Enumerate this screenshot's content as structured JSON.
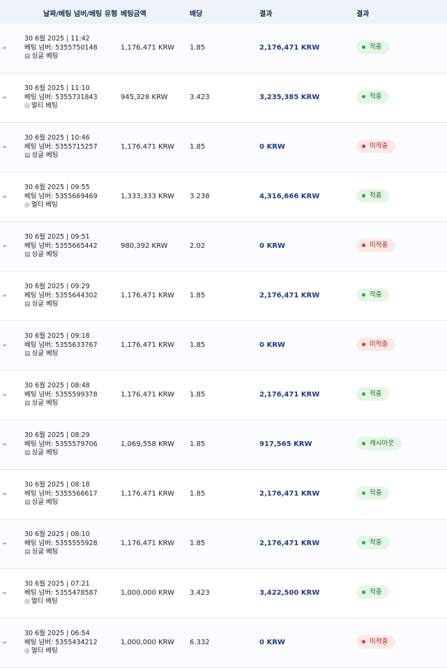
{
  "header": {
    "col_info": "날짜/베팅 넘버/베팅 유형",
    "col_amount": "베팅금액",
    "col_odds": "배당",
    "col_result": "결과",
    "col_status": "결과"
  },
  "rows": [
    {
      "date": "30 6월 2025 | 11:42",
      "bet_number": "베팅 넘버: 5355750148",
      "type_icon": "▤",
      "type": "싱글 베팅",
      "amount": "1,176,471 KRW",
      "odds": "1.85",
      "result": "2,176,471 KRW",
      "status": "적중",
      "status_kind": "win"
    },
    {
      "date": "30 6월 2025 | 11:10",
      "bet_number": "베팅 넘버: 5355731843",
      "type_icon": "◎",
      "type": "멀티 베팅",
      "amount": "945,328 KRW",
      "odds": "3.423",
      "result": "3,235,385 KRW",
      "status": "적중",
      "status_kind": "win"
    },
    {
      "date": "30 6월 2025 | 10:46",
      "bet_number": "베팅 넘버: 5355715257",
      "type_icon": "▤",
      "type": "싱글 베팅",
      "amount": "1,176,471 KRW",
      "odds": "1.85",
      "result": "0 KRW",
      "status": "미적중",
      "status_kind": "lose"
    },
    {
      "date": "30 6월 2025 | 09:55",
      "bet_number": "베팅 넘버: 5355669469",
      "type_icon": "◎",
      "type": "멀티 베팅",
      "amount": "1,333,333 KRW",
      "odds": "3.238",
      "result": "4,316,666 KRW",
      "status": "적중",
      "status_kind": "win"
    },
    {
      "date": "30 6월 2025 | 09:51",
      "bet_number": "베팅 넘버: 5355665442",
      "type_icon": "▤",
      "type": "싱글 베팅",
      "amount": "980,392 KRW",
      "odds": "2.02",
      "result": "0 KRW",
      "status": "미적중",
      "status_kind": "lose"
    },
    {
      "date": "30 6월 2025 | 09:29",
      "bet_number": "베팅 넘버: 5355644302",
      "type_icon": "▤",
      "type": "싱글 베팅",
      "amount": "1,176,471 KRW",
      "odds": "1.85",
      "result": "2,176,471 KRW",
      "status": "적중",
      "status_kind": "win"
    },
    {
      "date": "30 6월 2025 | 09:18",
      "bet_number": "베팅 넘버: 5355633767",
      "type_icon": "▤",
      "type": "싱글 베팅",
      "amount": "1,176,471 KRW",
      "odds": "1.85",
      "result": "0 KRW",
      "status": "미적중",
      "status_kind": "lose"
    },
    {
      "date": "30 6월 2025 | 08:48",
      "bet_number": "베팅 넘버: 5355599378",
      "type_icon": "▤",
      "type": "싱글 베팅",
      "amount": "1,176,471 KRW",
      "odds": "1.85",
      "result": "2,176,471 KRW",
      "status": "적중",
      "status_kind": "win"
    },
    {
      "date": "30 6월 2025 | 08:29",
      "bet_number": "베팅 넘버: 5355579706",
      "type_icon": "▤",
      "type": "싱글 베팅",
      "amount": "1,069,558 KRW",
      "odds": "1.85",
      "result": "917,565 KRW",
      "status": "캐시아웃",
      "status_kind": "cash"
    },
    {
      "date": "30 6월 2025 | 08:18",
      "bet_number": "베팅 넘버: 5355566617",
      "type_icon": "▤",
      "type": "싱글 베팅",
      "amount": "1,176,471 KRW",
      "odds": "1.85",
      "result": "2,176,471 KRW",
      "status": "적중",
      "status_kind": "win"
    },
    {
      "date": "30 6월 2025 | 08:10",
      "bet_number": "베팅 넘버: 5355555928",
      "type_icon": "▤",
      "type": "싱글 베팅",
      "amount": "1,176,471 KRW",
      "odds": "1.85",
      "result": "2,176,471 KRW",
      "status": "적중",
      "status_kind": "win"
    },
    {
      "date": "30 6월 2025 | 07:21",
      "bet_number": "베팅 넘버: 5355478587",
      "type_icon": "◎",
      "type": "멀티 베팅",
      "amount": "1,000,000 KRW",
      "odds": "3.423",
      "result": "3,422,500 KRW",
      "status": "적중",
      "status_kind": "win"
    },
    {
      "date": "30 6월 2025 | 06:54",
      "bet_number": "베팅 넘버: 5355434212",
      "type_icon": "◎",
      "type": "멀티 베팅",
      "amount": "1,000,000 KRW",
      "odds": "6.332",
      "result": "0 KRW",
      "status": "미적중",
      "status_kind": "lose"
    }
  ]
}
